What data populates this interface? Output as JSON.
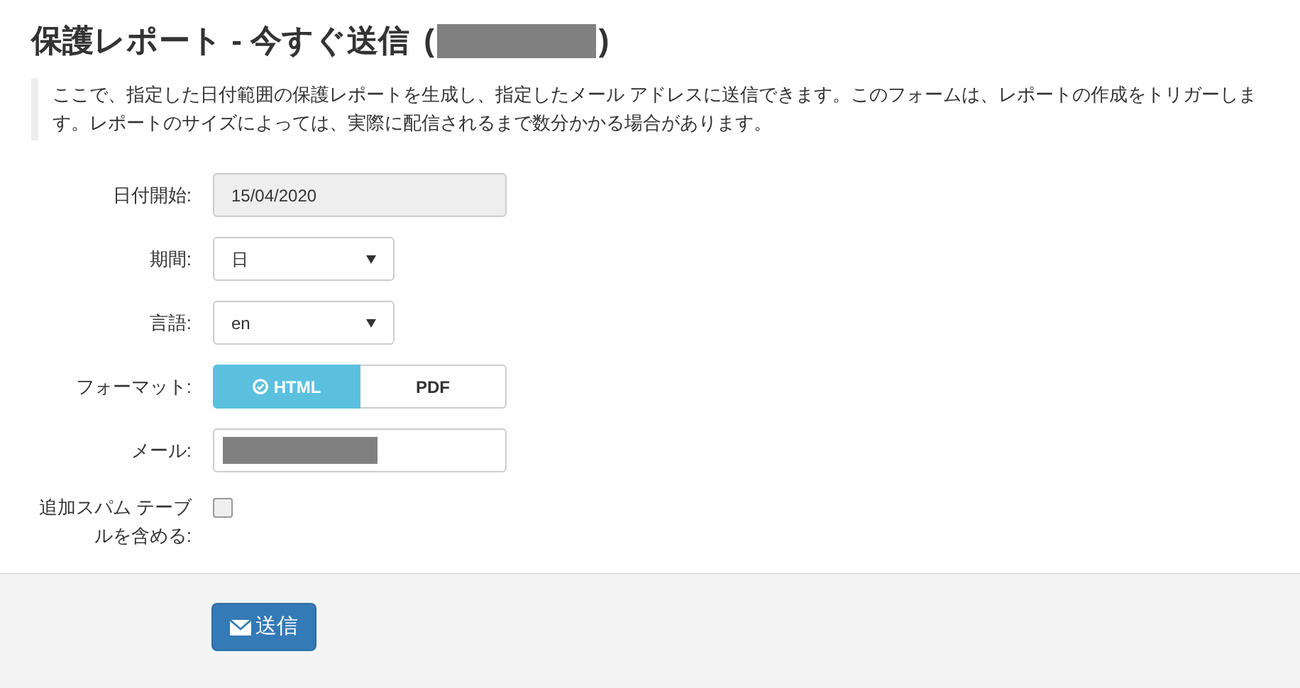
{
  "title": {
    "text": "保護レポート - 今すぐ送信",
    "open_paren": "(",
    "close_paren": ")",
    "redacted": true
  },
  "description": "ここで、指定した日付範囲の保護レポートを生成し、指定したメール アドレスに送信できます。このフォームは、レポートの作成をトリガーします。レポートのサイズによっては、実際に配信されるまで数分かかる場合があります。",
  "fields": [
    {
      "kind": "readonly",
      "label": "日付開始:",
      "value": "15/04/2020"
    },
    {
      "kind": "select",
      "label": "期間:",
      "value": "日"
    },
    {
      "kind": "select",
      "label": "言語:",
      "value": "en"
    },
    {
      "kind": "toggle",
      "label": "フォーマット:",
      "options": [
        {
          "label": "HTML",
          "selected": true
        },
        {
          "label": "PDF",
          "selected": false
        }
      ]
    },
    {
      "kind": "text",
      "label": "メール:",
      "redacted": true
    },
    {
      "kind": "checkbox",
      "label": "追加スパム テーブルを含める:",
      "checked": false
    }
  ],
  "submit_button": "送信"
}
